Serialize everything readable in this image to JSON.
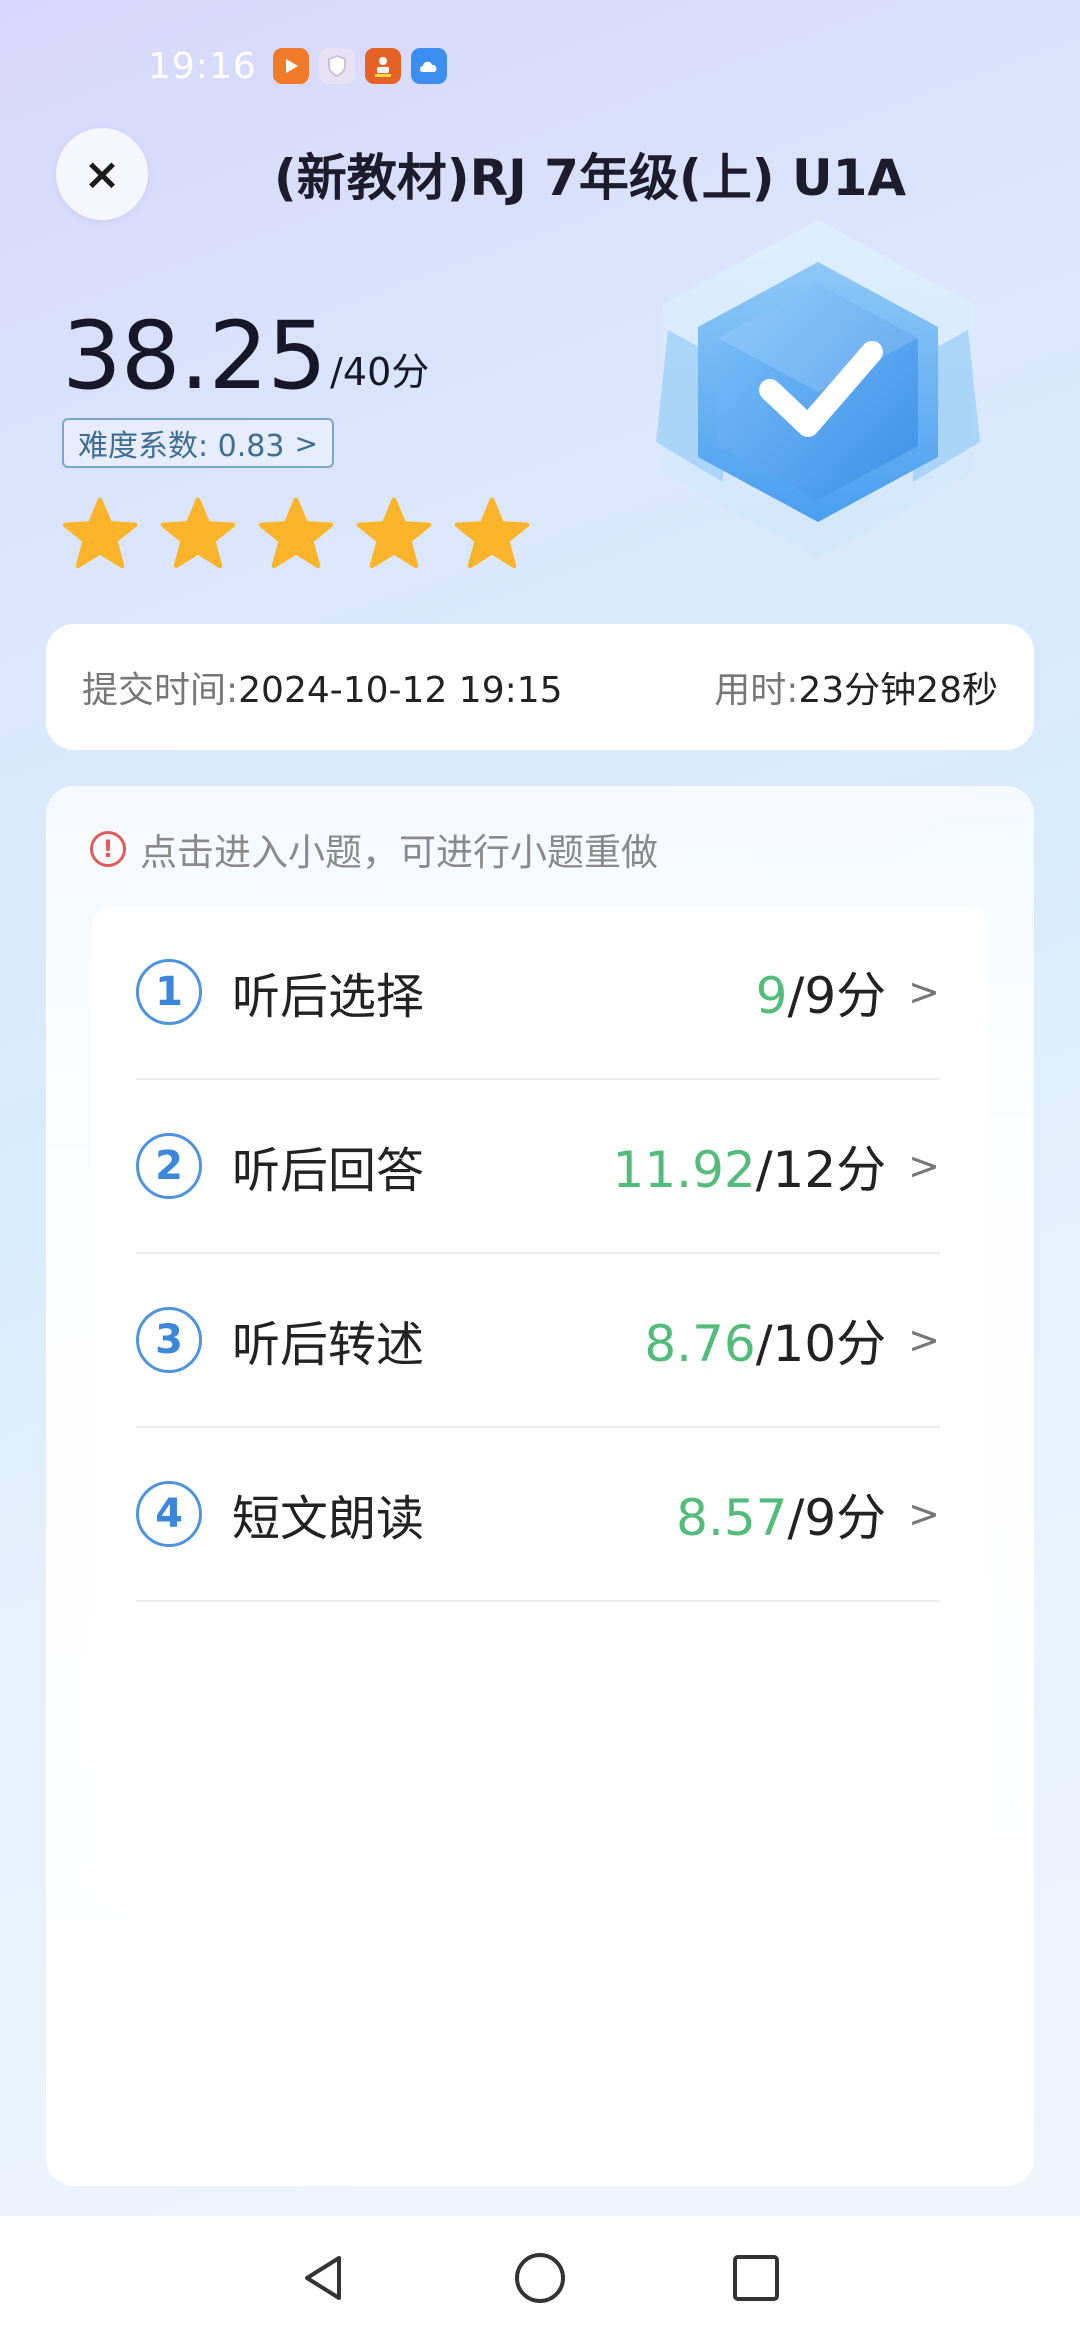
{
  "status_bar": {
    "time": "19:16",
    "apps": [
      {
        "icon": "video-app-icon",
        "color": "#f07b2b"
      },
      {
        "icon": "shield-app-icon",
        "color": "#e8e3f2"
      },
      {
        "icon": "game-app-icon",
        "color": "#e46226"
      },
      {
        "icon": "cloud-app-icon",
        "color": "#3c8ef0"
      }
    ]
  },
  "header": {
    "close_label": "×",
    "title": "(新教材)RJ 7年级(上) U1A"
  },
  "score": {
    "value": "38.25",
    "total": "/40分",
    "difficulty": "难度系数: 0.83",
    "difficulty_arrow": ">",
    "stars": 5,
    "star_color": "#fcb52a"
  },
  "info": {
    "submit_label": "提交时间:",
    "submit_value": "2024-10-12 19:15",
    "duration_label": "用时:",
    "duration_value": "23分钟28秒"
  },
  "notice": {
    "icon": "!",
    "text": "点击进入小题，可进行小题重做"
  },
  "sections": [
    {
      "num": "1",
      "label": "听后选择",
      "got": "9",
      "total": "/9分"
    },
    {
      "num": "2",
      "label": "听后回答",
      "got": "11.92",
      "total": "/12分"
    },
    {
      "num": "3",
      "label": "听后转述",
      "got": "8.76",
      "total": "/10分"
    },
    {
      "num": "4",
      "label": "短文朗读",
      "got": "8.57",
      "total": "/9分"
    }
  ],
  "row_chevron": ">",
  "colors": {
    "accent_blue": "#3c86db",
    "score_green": "#52bd7a"
  }
}
